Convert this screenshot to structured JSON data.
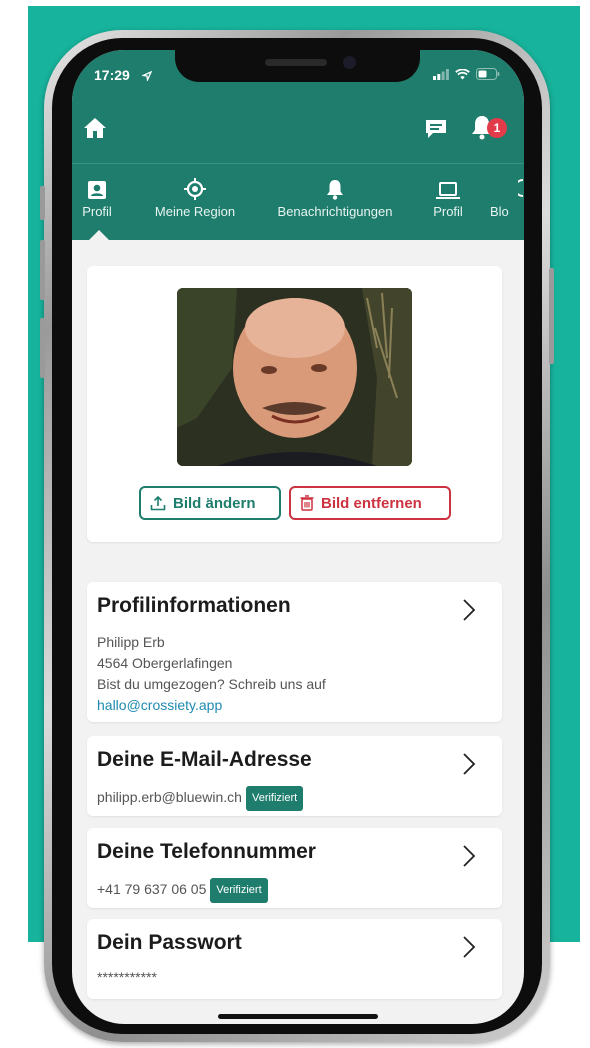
{
  "status": {
    "time": "17:29"
  },
  "header": {
    "notification_count": "1"
  },
  "tabs": [
    {
      "label": "Profil",
      "icon": "profile-card-icon"
    },
    {
      "label": "Meine Region",
      "icon": "location-target-icon"
    },
    {
      "label": "Benachrichtigungen",
      "icon": "bell-icon"
    },
    {
      "label": "Profil",
      "icon": "laptop-icon"
    },
    {
      "label": "Blo",
      "icon": "unknown-icon"
    }
  ],
  "photo_card": {
    "change_label": "Bild ändern",
    "remove_label": "Bild entfernen"
  },
  "profile_info": {
    "title": "Profilinformationen",
    "name": "Philipp Erb",
    "address": "4564 Obergerlafingen",
    "moved_text": "Bist du umgezogen? Schreib uns auf",
    "email_link": "hallo@crossiety.app"
  },
  "email": {
    "title": "Deine E-Mail-Adresse",
    "value": "philipp.erb@bluewin.ch",
    "badge": "Verifiziert"
  },
  "phone": {
    "title": "Deine Telefonnummer",
    "value": "+41 79 637 06 05",
    "badge": "Verifiziert"
  },
  "password": {
    "title": "Dein Passwort",
    "value": "***********"
  },
  "colors": {
    "brand": "#1e7d6c",
    "background_teal": "#17b39c",
    "danger": "#cc3240",
    "badge_red": "#e23b4a",
    "link": "#1f8ab0"
  }
}
